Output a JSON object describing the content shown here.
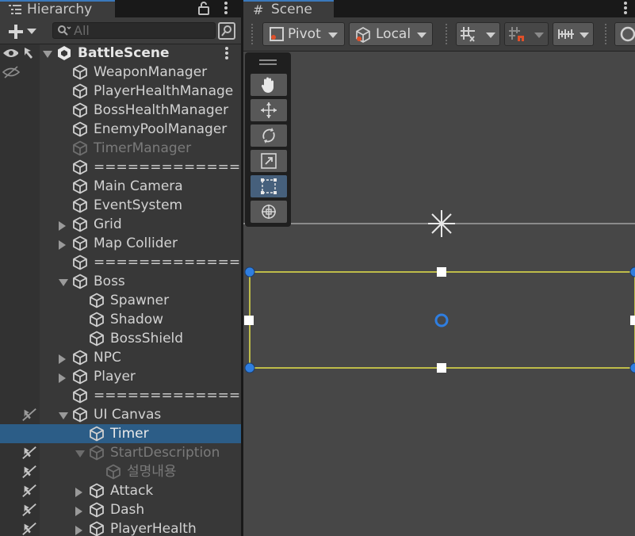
{
  "hierarchy": {
    "tab_title": "Hierarchy",
    "search_placeholder": "All",
    "scene_name": "BattleScene",
    "rows": [
      {
        "label": "WeaponManager"
      },
      {
        "label": "PlayerHealthManage"
      },
      {
        "label": "BossHealthManager"
      },
      {
        "label": "EnemyPoolManager"
      },
      {
        "label": "TimerManager"
      },
      {
        "label": "==============="
      },
      {
        "label": "Main Camera"
      },
      {
        "label": "EventSystem"
      },
      {
        "label": "Grid"
      },
      {
        "label": "Map Collider"
      },
      {
        "label": "==============="
      },
      {
        "label": "Boss"
      },
      {
        "label": "Spawner"
      },
      {
        "label": "Shadow"
      },
      {
        "label": "BossShield"
      },
      {
        "label": "NPC"
      },
      {
        "label": "Player"
      },
      {
        "label": "==============="
      },
      {
        "label": "UI Canvas"
      },
      {
        "label": "Timer"
      },
      {
        "label": "StartDescription"
      },
      {
        "label": "설명내용"
      },
      {
        "label": "Attack"
      },
      {
        "label": "Dash"
      },
      {
        "label": "PlayerHealth"
      }
    ]
  },
  "scene": {
    "tab_title": "Scene",
    "pivot_label": "Pivot",
    "local_label": "Local"
  },
  "colors": {
    "selection": "#2c5d87",
    "tab_accent": "#3a79bb",
    "rect_outline": "#e6e34a",
    "handle_blue": "#2f7ee0"
  }
}
